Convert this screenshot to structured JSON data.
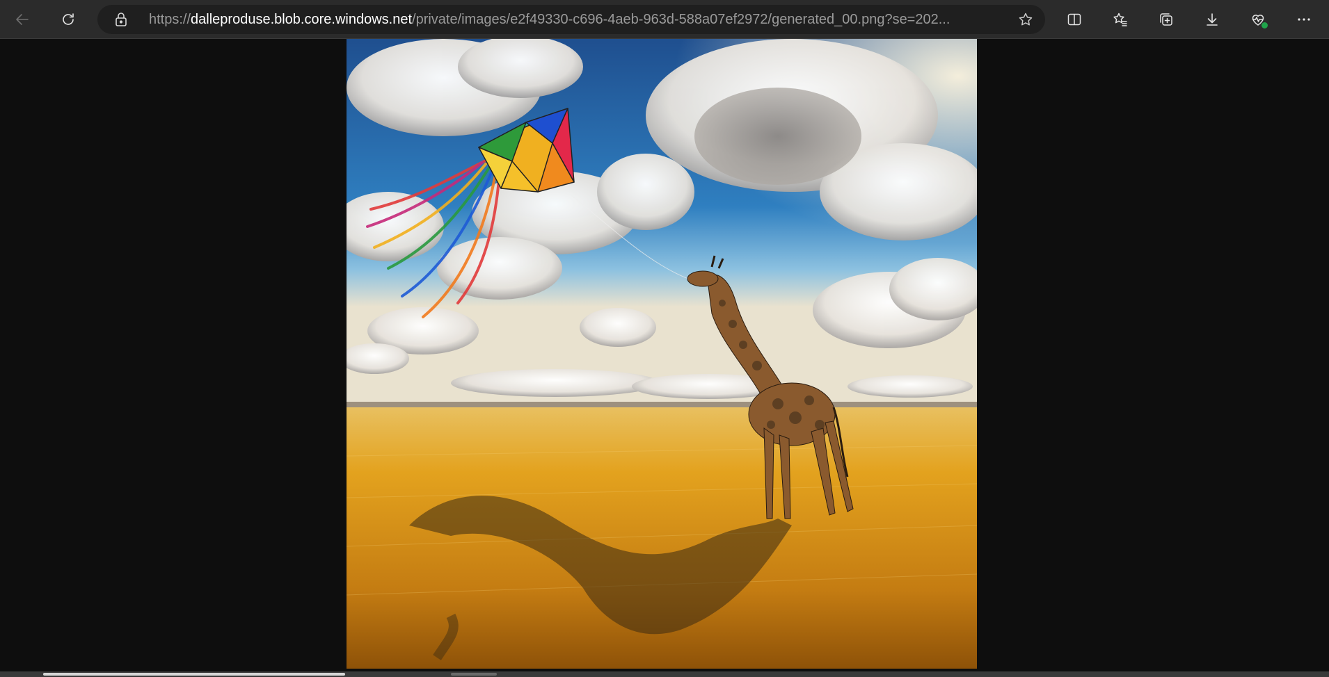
{
  "toolbar": {
    "back": "back-arrow-icon",
    "refresh": "refresh-icon",
    "split": "split-screen-icon",
    "favorites": "favorites-list-icon",
    "collections": "collections-icon",
    "downloads": "download-icon",
    "health": "browser-essentials-icon",
    "more": "more-options-icon"
  },
  "address": {
    "scheme": "https://",
    "host": "dalleproduse.blob.core.windows.net",
    "path": "/private/images/e2f49330-c696-4aeb-963d-588a07ef2972/generated_00.png?se=202...",
    "lock_icon": "lock-icon",
    "favorite_icon": "star-icon"
  },
  "content": {
    "image_description_icon": "generated-image",
    "background": "#0e0e0e"
  },
  "colors": {
    "toolbar_bg": "#2b2b2b",
    "address_bg": "#1f1f1f",
    "health_dot": "#1fa34a"
  }
}
